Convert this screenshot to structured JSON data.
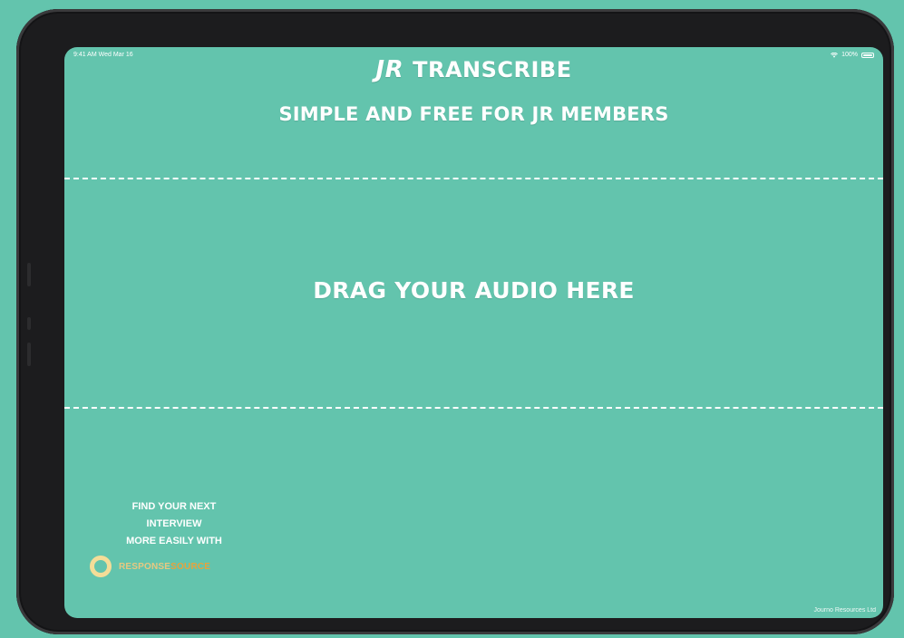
{
  "status_bar": {
    "time_date": "9:41 AM  Wed Mar 16",
    "battery": "100%"
  },
  "header": {
    "brand": "JR",
    "title": "TRANSCRIBE",
    "subtitle": "SIMPLE AND FREE FOR JR MEMBERS"
  },
  "drop_zone": {
    "label": "DRAG YOUR AUDIO HERE"
  },
  "promo": {
    "line1": "FIND YOUR NEXT",
    "line2": "INTERVIEW",
    "line3": "MORE EASILY WITH",
    "logo_text_primary": "RESPONSE",
    "logo_text_accent": "SOURCE",
    "icons": [
      "logo-ring-icon"
    ]
  },
  "footer": {
    "credit": "Journo Resources Ltd"
  },
  "colors": {
    "background": "#63c4ad",
    "text": "#ffffff",
    "logo_ring": "#f4dd98",
    "logo_accent": "#e9a23b"
  }
}
